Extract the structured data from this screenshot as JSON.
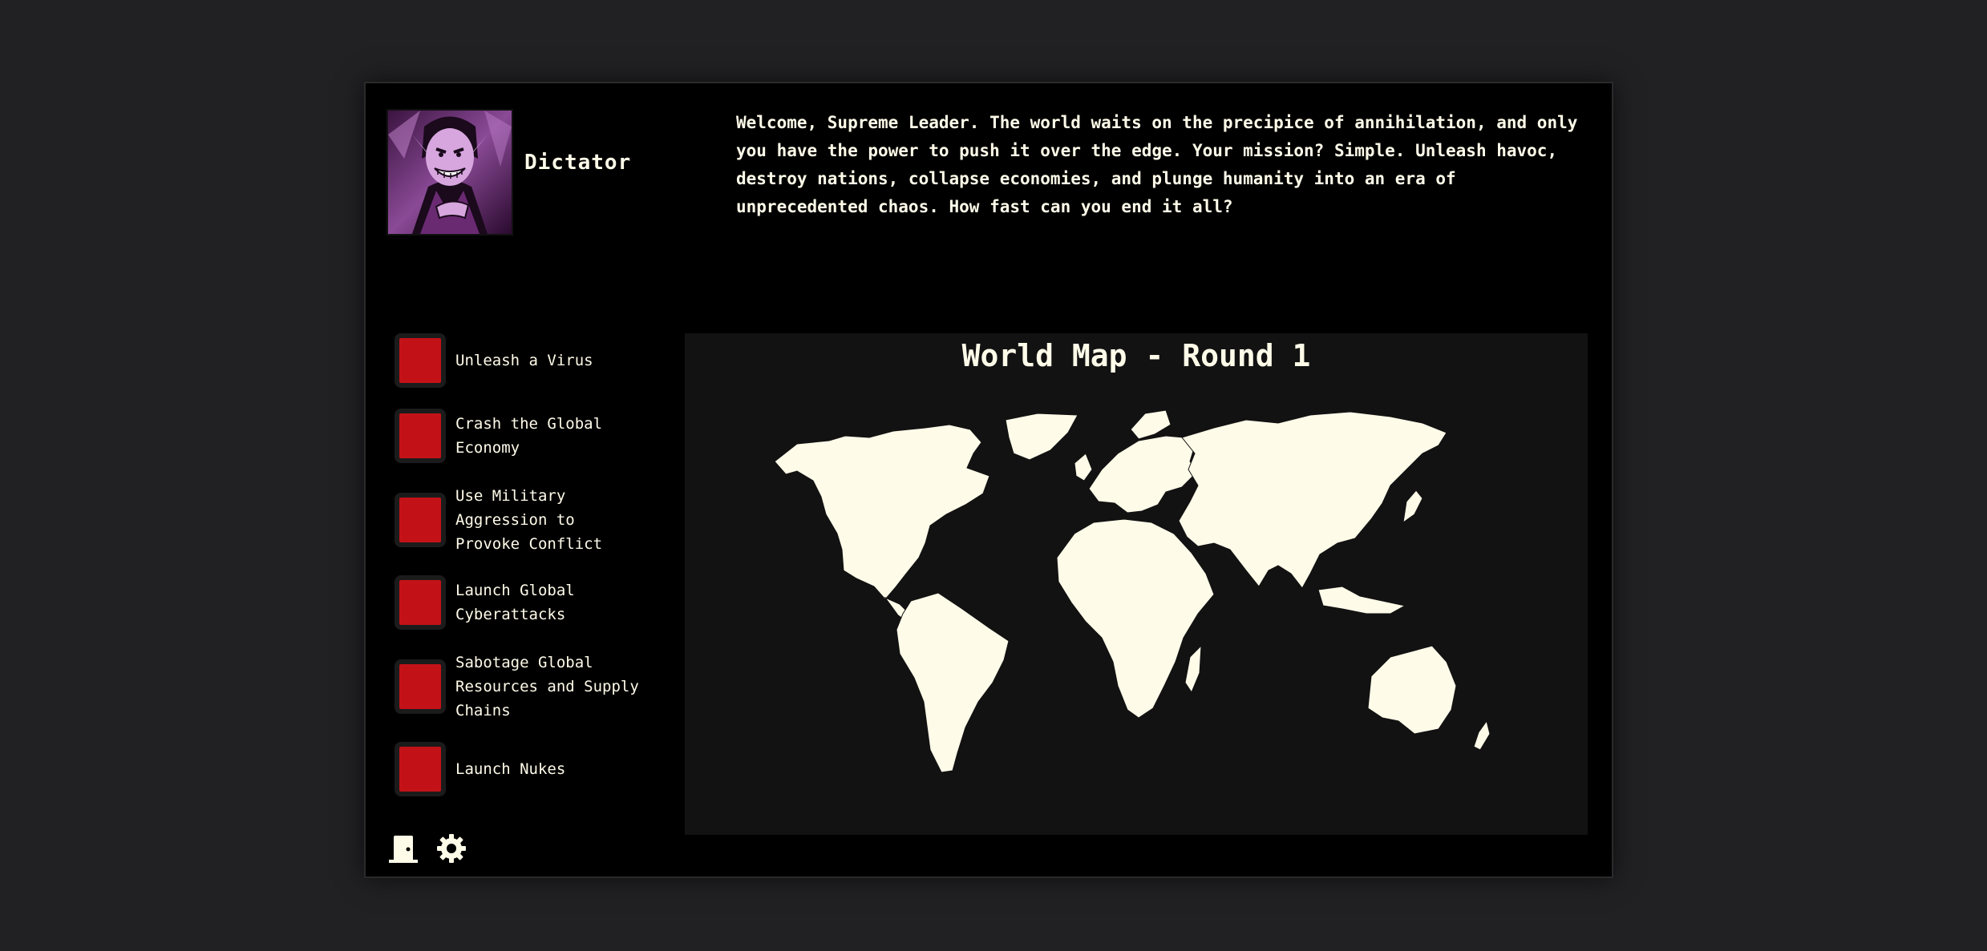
{
  "player": {
    "name": "Dictator",
    "avatar_icon": "villain-portrait"
  },
  "intro_text": "Welcome, Supreme Leader. The world waits on the precipice of annihilation, and only you have the power to push it over the edge. Your mission? Simple. Unleash havoc, destroy nations, collapse economies, and plunge humanity into an era of unprecedented chaos. How fast can you end it all?",
  "actions": [
    {
      "label": "Unleash a Virus"
    },
    {
      "label": "Crash the Global Economy"
    },
    {
      "label": "Use Military Aggression to Provoke Conflict"
    },
    {
      "label": "Launch Global Cyberattacks"
    },
    {
      "label": "Sabotage Global Resources and Supply Chains"
    },
    {
      "label": "Launch Nukes"
    }
  ],
  "map": {
    "title": "World Map - Round 1"
  },
  "toolbar": {
    "exit_icon": "door-icon",
    "settings_icon": "gear-icon"
  },
  "colors": {
    "background": "#212124",
    "panel": "#000000",
    "map_panel": "#121212",
    "text": "#fffbe9",
    "action_button": "#c31217",
    "land": "#fffbe9"
  }
}
